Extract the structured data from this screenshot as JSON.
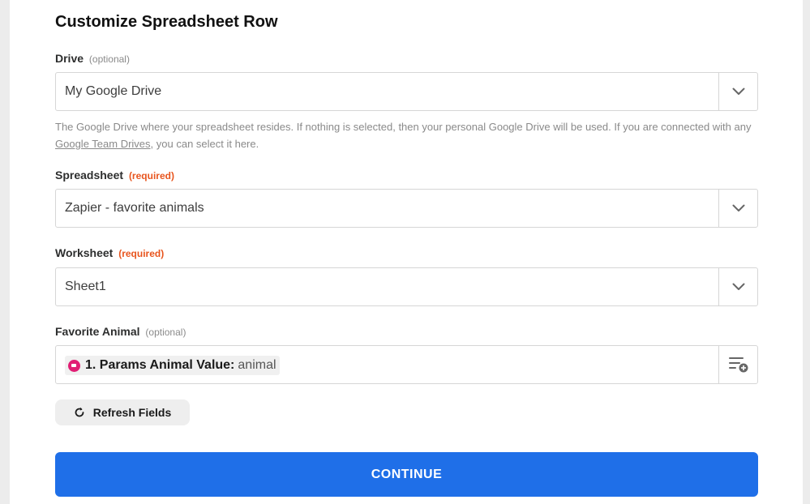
{
  "form": {
    "title": "Customize Spreadsheet Row",
    "drive": {
      "label": "Drive",
      "tag": "(optional)",
      "value": "My Google Drive",
      "help_before": "The Google Drive where your spreadsheet resides. If nothing is selected, then your personal Google Drive will be used. If you are connected with any ",
      "help_link": "Google Team Drives",
      "help_after": ", you can select it here.",
      "icon": "chevron-down-icon"
    },
    "spreadsheet": {
      "label": "Spreadsheet",
      "tag": "(required)",
      "value": "Zapier - favorite animals",
      "icon": "chevron-down-icon"
    },
    "worksheet": {
      "label": "Worksheet",
      "tag": "(required)",
      "value": "Sheet1",
      "icon": "chevron-down-icon"
    },
    "favorite_animal": {
      "label": "Favorite Animal",
      "tag": "(optional)",
      "pill_step": "1. Params Animal Value:",
      "pill_value": "animal",
      "icon": "insert-data-icon"
    },
    "refresh_label": "Refresh Fields",
    "continue_label": "CONTINUE"
  },
  "colors": {
    "accent": "#1f6fe8",
    "required": "#e8551e",
    "app_icon": "#e11d74"
  }
}
